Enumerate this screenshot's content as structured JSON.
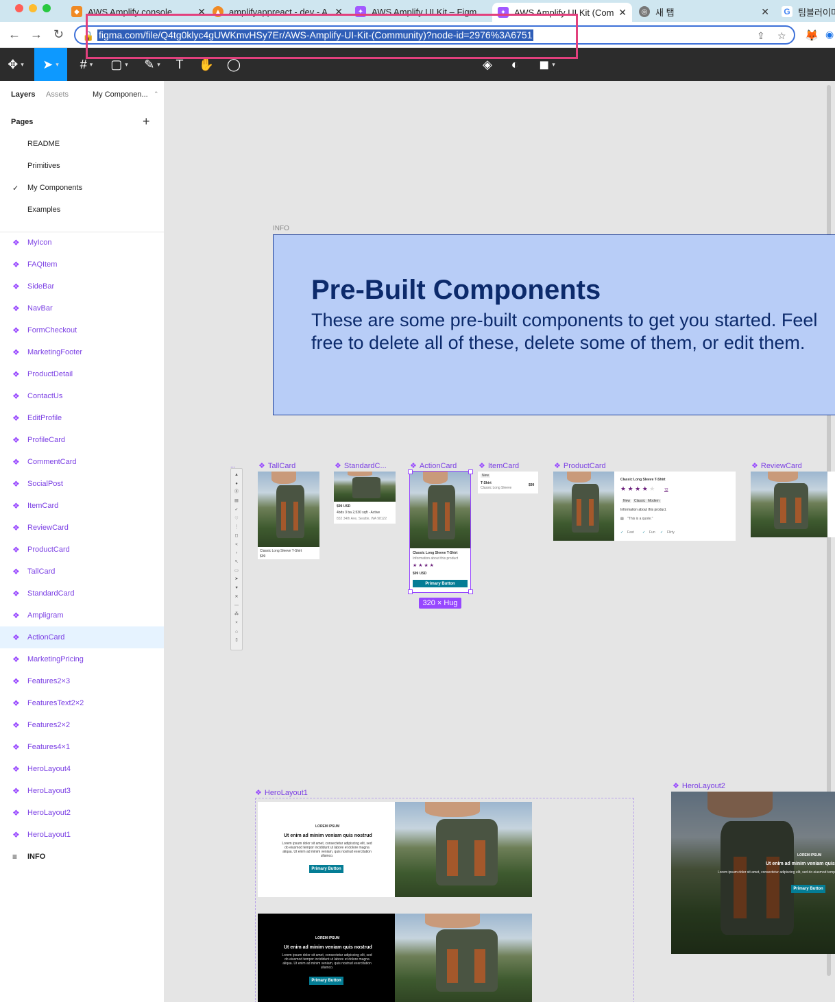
{
  "tabs": [
    {
      "title": "AWS Amplify console",
      "color": "#f08a24"
    },
    {
      "title": "amplifyappreact - dev - A",
      "color": "#f08a24"
    },
    {
      "title": "AWS Amplify UI Kit – Figm",
      "color": "#a259ff"
    },
    {
      "title": "AWS Amplify UI Kit (Comm",
      "color": "#a259ff"
    },
    {
      "title": "새 탭",
      "color": "#888888"
    },
    {
      "title": "팀블러이미",
      "color": "#4285f4"
    }
  ],
  "address": {
    "url": "figma.com/file/Q4tg0klyc4gUWKmvHSy7Er/AWS-Amplify-UI-Kit-(Community)?node-id=2976%3A6751"
  },
  "panel": {
    "tab_layers": "Layers",
    "tab_assets": "Assets",
    "page_switch": "My Componen...",
    "pages_header": "Pages",
    "pages": [
      "README",
      "Primitives",
      "My Components",
      "Examples"
    ],
    "current_page": "My Components",
    "layers": [
      "MyIcon",
      "FAQItem",
      "SideBar",
      "NavBar",
      "FormCheckout",
      "MarketingFooter",
      "ProductDetail",
      "ContactUs",
      "EditProfile",
      "ProfileCard",
      "CommentCard",
      "SocialPost",
      "ItemCard",
      "ReviewCard",
      "ProductCard",
      "TallCard",
      "StandardCard",
      "Ampligram",
      "ActionCard",
      "MarketingPricing",
      "Features2×3",
      "FeaturesText2×2",
      "Features2×2",
      "Features4×1",
      "HeroLayout4",
      "HeroLayout3",
      "HeroLayout2",
      "HeroLayout1"
    ],
    "selected_layer": "ActionCard",
    "info_layer": "INFO"
  },
  "canvas": {
    "info_label": "INFO",
    "info_title": "Pre-Built Components",
    "info_body": "These are some pre-built components to get you started. Feel free to delete all of these, delete some of them, or edit them.",
    "frames": {
      "tallcard": "TallCard",
      "standardcard": "StandardC...",
      "actioncard": "ActionCard",
      "itemcard": "ItemCard",
      "productcard": "ProductCard",
      "reviewcard": "ReviewCard",
      "herolayout1": "HeroLayout1",
      "herolayout2": "HeroLayout2"
    },
    "size_tag": "320 × Hug",
    "tallcard_text": "Classic Long Sleeve T-Shirt",
    "tallcard_price": "$99",
    "standard_price": "$99 USD",
    "standard_info": "4bds 3 ba 2,530 sqft - Active",
    "standard_addr": "832 34th Ave, Seattle, WA 98122",
    "action_title": "Classic Long Sleeve T-Shirt",
    "action_info": "Information about this product",
    "action_price": "$99 USD",
    "action_button": "Primary Button",
    "item_badge": "New",
    "item_title": "T-Shirt",
    "item_sub": "Classic Long Sleeve",
    "item_price": "$99",
    "product_title": "Classic Long Sleeve T-Shirt",
    "product_info": "Information about this product.",
    "product_quote": "\"This is a quote.\"",
    "product_tags": [
      "New",
      "Classic",
      "Modern"
    ],
    "product_features": [
      "Fast",
      "Fun",
      "Flirty"
    ],
    "product_reviews": "72",
    "hero_eyebrow": "LOREM IPSUM",
    "hero_heading": "Ut enim ad minim veniam quis nostrud",
    "hero_body": "Lorem ipsum dolor sit amet, consectetur adipiscing elit, sed do eiusmod tempor incididunt ut labore et dolore magna aliqua. Ut enim ad minim veniam, quis nostrud exercitation ullamco.",
    "hero_button": "Primary Button"
  }
}
